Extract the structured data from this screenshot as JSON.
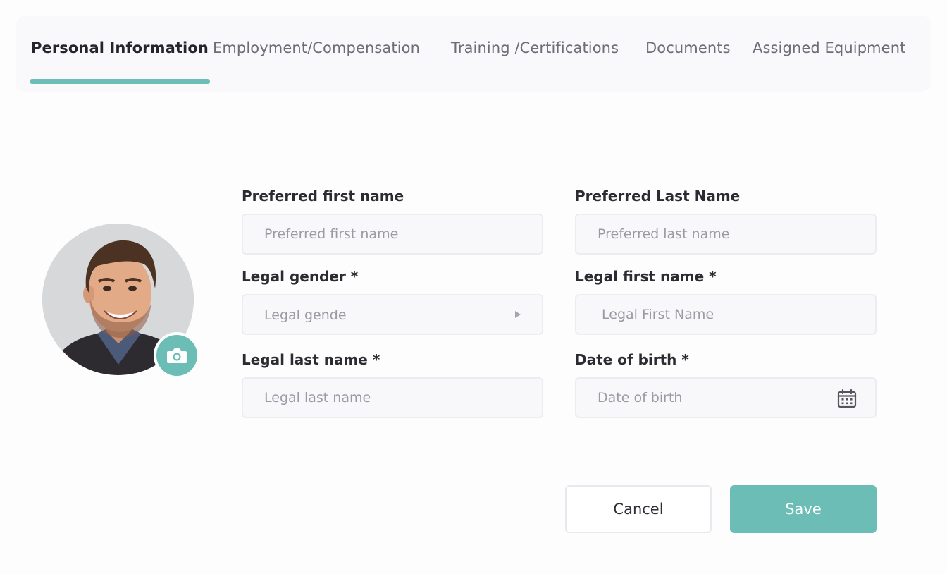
{
  "colors": {
    "accent": "#6bbdb6",
    "background": "#fdfdfe",
    "tab_bar_bg": "#f9f9fc",
    "field_bg": "#f8f8fb"
  },
  "tabs": [
    {
      "label": "Personal Information",
      "active": true
    },
    {
      "label": "Employment/Compensation",
      "active": false
    },
    {
      "label": "Training /Certifications",
      "active": false
    },
    {
      "label": "Documents",
      "active": false
    },
    {
      "label": "Assigned Equipment",
      "active": false
    }
  ],
  "avatar": {
    "upload_icon": "camera-icon"
  },
  "form": {
    "preferred_first_name": {
      "label": "Preferred first name",
      "placeholder": "Preferred first name"
    },
    "preferred_last_name": {
      "label": "Preferred Last Name",
      "placeholder": "Preferred last name"
    },
    "legal_gender": {
      "label": "Legal gender *",
      "placeholder": "Legal gende",
      "icon": "caret-right-icon"
    },
    "legal_first_name": {
      "label": "Legal first name *",
      "placeholder": "Legal First Name"
    },
    "legal_last_name": {
      "label": "Legal last name *",
      "placeholder": "Legal last name"
    },
    "date_of_birth": {
      "label": "Date of birth *",
      "placeholder": "Date of birth",
      "icon": "calendar-icon"
    }
  },
  "actions": {
    "cancel_label": "Cancel",
    "save_label": "Save"
  }
}
